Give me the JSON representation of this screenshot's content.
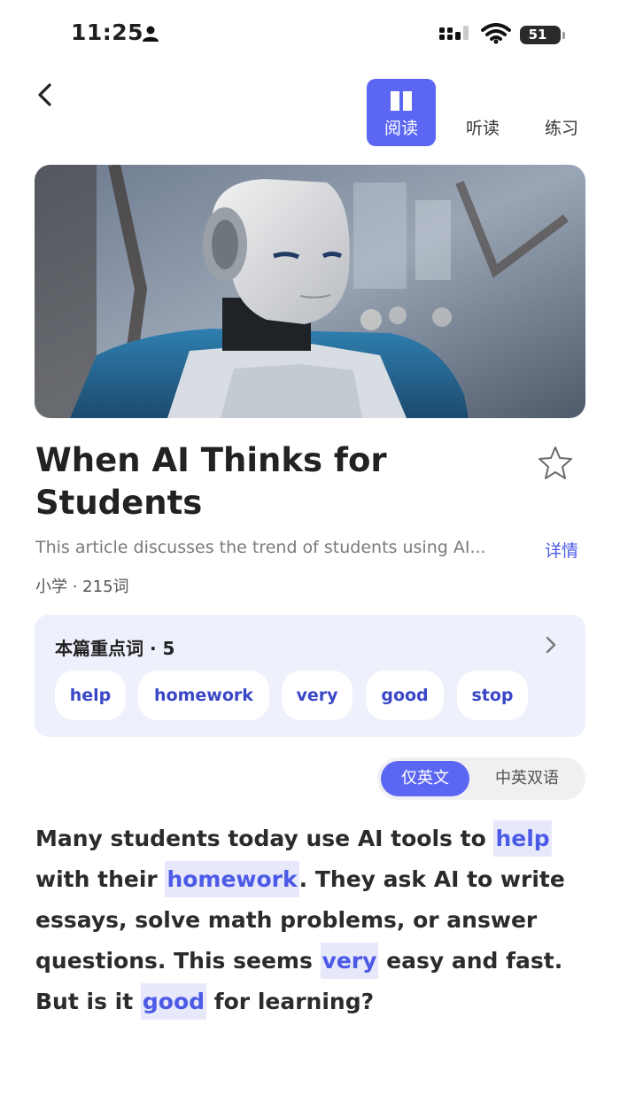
{
  "status_bar": {
    "time": "11:25",
    "battery": "51",
    "icons": [
      "person-icon",
      "signal-icon",
      "wifi-icon",
      "battery-icon"
    ]
  },
  "header": {
    "back_icon": "back-arrow-icon",
    "tabs": [
      {
        "label": "阅读",
        "icon": "book-icon",
        "active": true
      },
      {
        "label": "听读",
        "active": false
      },
      {
        "label": "练习",
        "active": false
      }
    ]
  },
  "article": {
    "title": "When AI Thinks for Students",
    "summary": "This article discusses the trend of students using AI...",
    "details_label": "详情",
    "meta": "小学 · 215词",
    "favorite_icon": "star-outline-icon"
  },
  "keywords": {
    "title": "本篇重点词 · 5",
    "items": [
      "help",
      "homework",
      "very",
      "good",
      "stop"
    ]
  },
  "language_toggle": {
    "options": [
      "仅英文",
      "中英双语"
    ],
    "selected": "仅英文"
  },
  "body": {
    "segments": [
      {
        "text": "Many students today use AI tools to ",
        "kw": false
      },
      {
        "text": "help",
        "kw": true
      },
      {
        "text": " with their ",
        "kw": false
      },
      {
        "text": "homework",
        "kw": true
      },
      {
        "text": ". They ask AI to write essays, solve math problems, or answer questions. This seems ",
        "kw": false
      },
      {
        "text": "very",
        "kw": true
      },
      {
        "text": " easy and fast. But is it ",
        "kw": false
      },
      {
        "text": "good",
        "kw": true
      },
      {
        "text": " for learning?",
        "kw": false
      }
    ]
  },
  "colors": {
    "accent": "#5b67f3",
    "keyword_text": "#4c5ae6",
    "keyword_bg": "#e7e9fb",
    "card_bg": "#eef0fc"
  }
}
